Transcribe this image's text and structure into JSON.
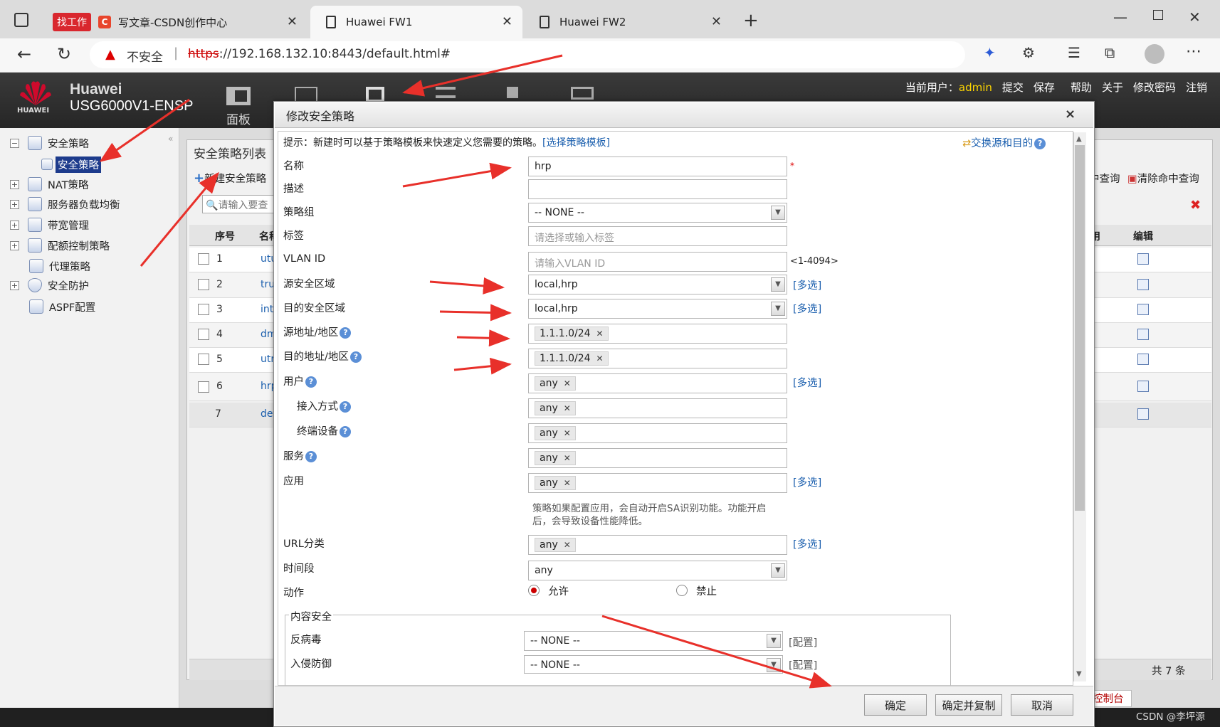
{
  "browser": {
    "tabs": [
      {
        "label": "写文章-CSDN创作中心",
        "badge": "找工作"
      },
      {
        "label": "Huawei FW1"
      },
      {
        "label": "Huawei FW2"
      }
    ],
    "security_label": "不安全",
    "url_scheme": "https",
    "url_rest": "://192.168.132.10:8443/default.html#"
  },
  "app": {
    "brand": "Huawei",
    "model": "USG6000V1-ENSP",
    "logo_text": "HUAWEI",
    "nav_label": "面板",
    "user_prefix": "当前用户：",
    "user": "admin",
    "top_links": [
      "提交",
      "保存",
      "帮助",
      "关于",
      "修改密码",
      "注销"
    ]
  },
  "sidebar": {
    "items": [
      "安全策略",
      "安全策略",
      "NAT策略",
      "服务器负载均衡",
      "带宽管理",
      "配额控制策略",
      "代理策略",
      "安全防护",
      "ASPF配置"
    ]
  },
  "list": {
    "title": "安全策略列表",
    "new_button": "新建安全策略",
    "search_placeholder": "请输入要查",
    "headers": {
      "no": "序号",
      "name": "名称",
      "enable": "用",
      "edit": "编辑"
    },
    "query_btn": "中查询",
    "clear_btn": "清除命中查询",
    "rows": [
      {
        "no": "1",
        "name": "utu"
      },
      {
        "no": "2",
        "name": "tru"
      },
      {
        "no": "3",
        "name": "inte"
      },
      {
        "no": "4",
        "name": "dm"
      },
      {
        "no": "5",
        "name": "utr"
      },
      {
        "no": "6",
        "name": "hrp"
      },
      {
        "no": "7",
        "name": "def"
      }
    ],
    "total": "共 7 条",
    "console": "控制台"
  },
  "modal": {
    "title": "修改安全策略",
    "close": "×",
    "hint": "提示：新建时可以基于策略模板来快速定义您需要的策略。",
    "hint_link": "[选择策略模板]",
    "swap_link": "交换源和目的",
    "fields": {
      "name_label": "名称",
      "name_value": "hrp",
      "desc_label": "描述",
      "group_label": "策略组",
      "group_value": "-- NONE --",
      "tag_label": "标签",
      "tag_placeholder": "请选择或输入标签",
      "vlan_label": "VLAN ID",
      "vlan_placeholder": "请输入VLAN ID",
      "vlan_range": "<1-4094>",
      "src_zone_label": "源安全区域",
      "src_zone_value": "local,hrp",
      "dst_zone_label": "目的安全区域",
      "dst_zone_value": "local,hrp",
      "src_addr_label": "源地址/地区",
      "src_addr_value": "1.1.1.0/24",
      "dst_addr_label": "目的地址/地区",
      "dst_addr_value": "1.1.1.0/24",
      "user_label": "用户",
      "user_value": "any",
      "access_label": "接入方式",
      "access_value": "any",
      "terminal_label": "终端设备",
      "terminal_value": "any",
      "service_label": "服务",
      "service_value": "any",
      "app_label": "应用",
      "app_value": "any",
      "app_note_1": "策略如果配置应用，会自动开启SA识别功能。功能开启",
      "app_note_2": "后，会导致设备性能降低。",
      "url_label": "URL分类",
      "url_value": "any",
      "time_label": "时间段",
      "time_value": "any",
      "action_label": "动作",
      "allow": "允许",
      "deny": "禁止",
      "content_legend": "内容安全",
      "av_label": "反病毒",
      "av_value": "-- NONE --",
      "ips_label": "入侵防御",
      "ips_value": "-- NONE --",
      "config_link": "[配置]"
    },
    "multi_link": "[多选]",
    "buttons": {
      "ok": "确定",
      "ok_copy": "确定并复制",
      "cancel": "取消"
    }
  },
  "watermark": "CSDN @李坪源",
  "colors": {
    "accent": "#1b5fae",
    "arrow": "#e8302a",
    "brand_red": "#cf0a2c"
  }
}
